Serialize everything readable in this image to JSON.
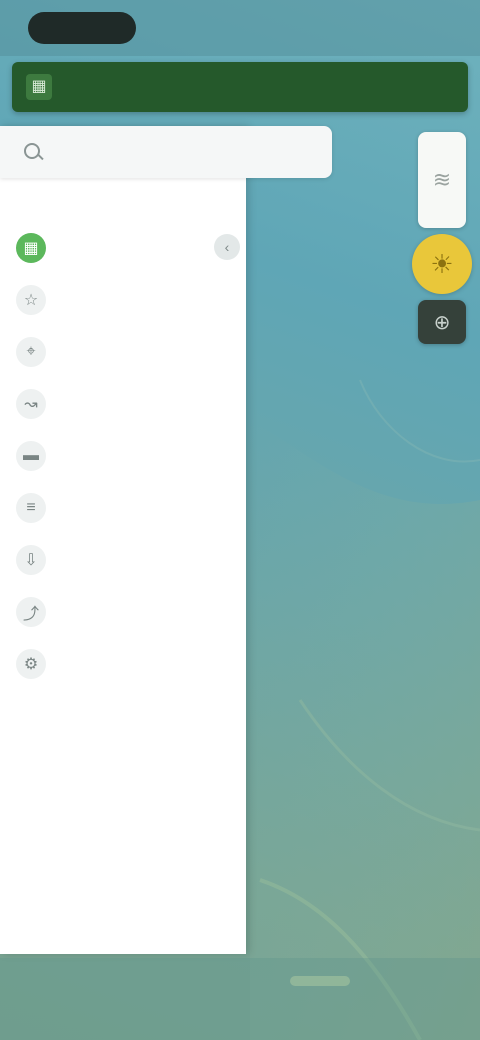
{
  "status_bar": {
    "pill_text": "",
    "show_pill": true
  },
  "banner": {
    "title": "",
    "icon": "map-icon"
  },
  "search": {
    "placeholder": "",
    "value": ""
  },
  "drawer": {
    "section_label": "",
    "items": [
      {
        "label": "",
        "icon": "map-icon",
        "active": true
      },
      {
        "label": "",
        "icon": "star-icon",
        "active": false
      },
      {
        "label": "",
        "icon": "location-icon",
        "active": false
      },
      {
        "label": "",
        "icon": "route-icon",
        "active": false
      },
      {
        "label": "",
        "icon": "folder-icon",
        "active": false
      },
      {
        "label": "",
        "icon": "layers-icon",
        "active": false
      },
      {
        "label": "",
        "icon": "download-icon",
        "active": false
      },
      {
        "label": "",
        "icon": "share-icon",
        "active": false
      },
      {
        "label": "",
        "icon": "settings-icon",
        "active": false
      },
      {
        "label": "",
        "icon": "",
        "active": false
      }
    ]
  },
  "map_controls": {
    "layers_icon": "layers-icon",
    "weather_icon": "sun-icon",
    "locate_icon": "crosshair-icon"
  },
  "colors": {
    "banner_bg": "#25592b",
    "active_accent": "#5cb85c",
    "weather_button": "#e9c73a",
    "map_water": "#5fa6b6"
  }
}
